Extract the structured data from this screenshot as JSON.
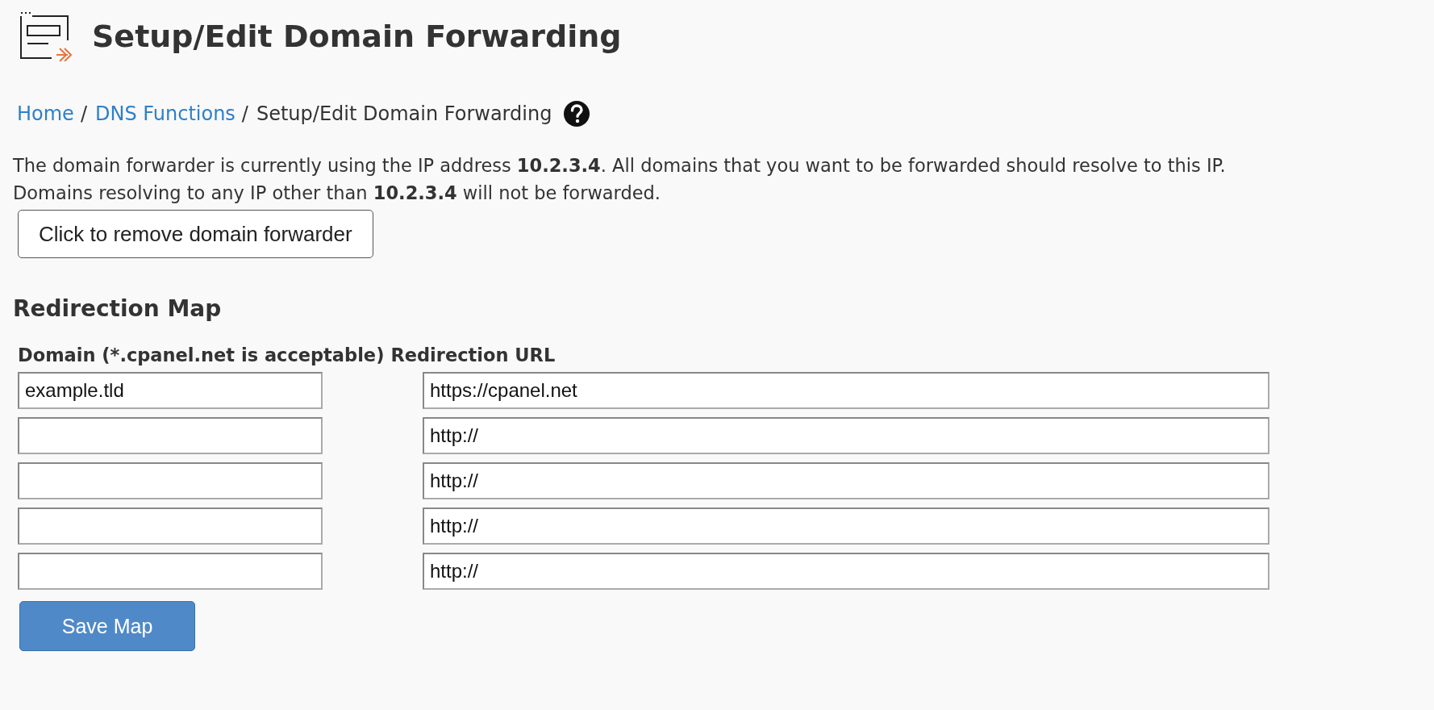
{
  "page_title": "Setup/Edit Domain Forwarding",
  "breadcrumb_separator": "/",
  "breadcrumbs": [
    {
      "label": "Home",
      "kind": "link"
    },
    {
      "label": "DNS Functions",
      "kind": "link"
    },
    {
      "label": "Setup/Edit Domain Forwarding",
      "kind": "current"
    }
  ],
  "info": [
    "The domain forwarder is currently using the IP address **10.2.3.4**. All domains that you want to be forwarded should resolve to this IP.",
    "Domains resolving to any IP other than **10.2.3.4** will not be forwarded."
  ],
  "remove_button": "Click to remove domain forwarder",
  "section_title": "Redirection Map",
  "columns": [
    "Domain (*.cpanel.net is acceptable)",
    "Redirection URL"
  ],
  "rows": [
    {
      "domain": "example.tld",
      "url": "https://cpanel.net"
    },
    {
      "url": "http://"
    },
    {
      "url": "http://"
    },
    {
      "url": "http://"
    },
    {
      "url": "http://"
    }
  ],
  "save_button": "Save Map"
}
